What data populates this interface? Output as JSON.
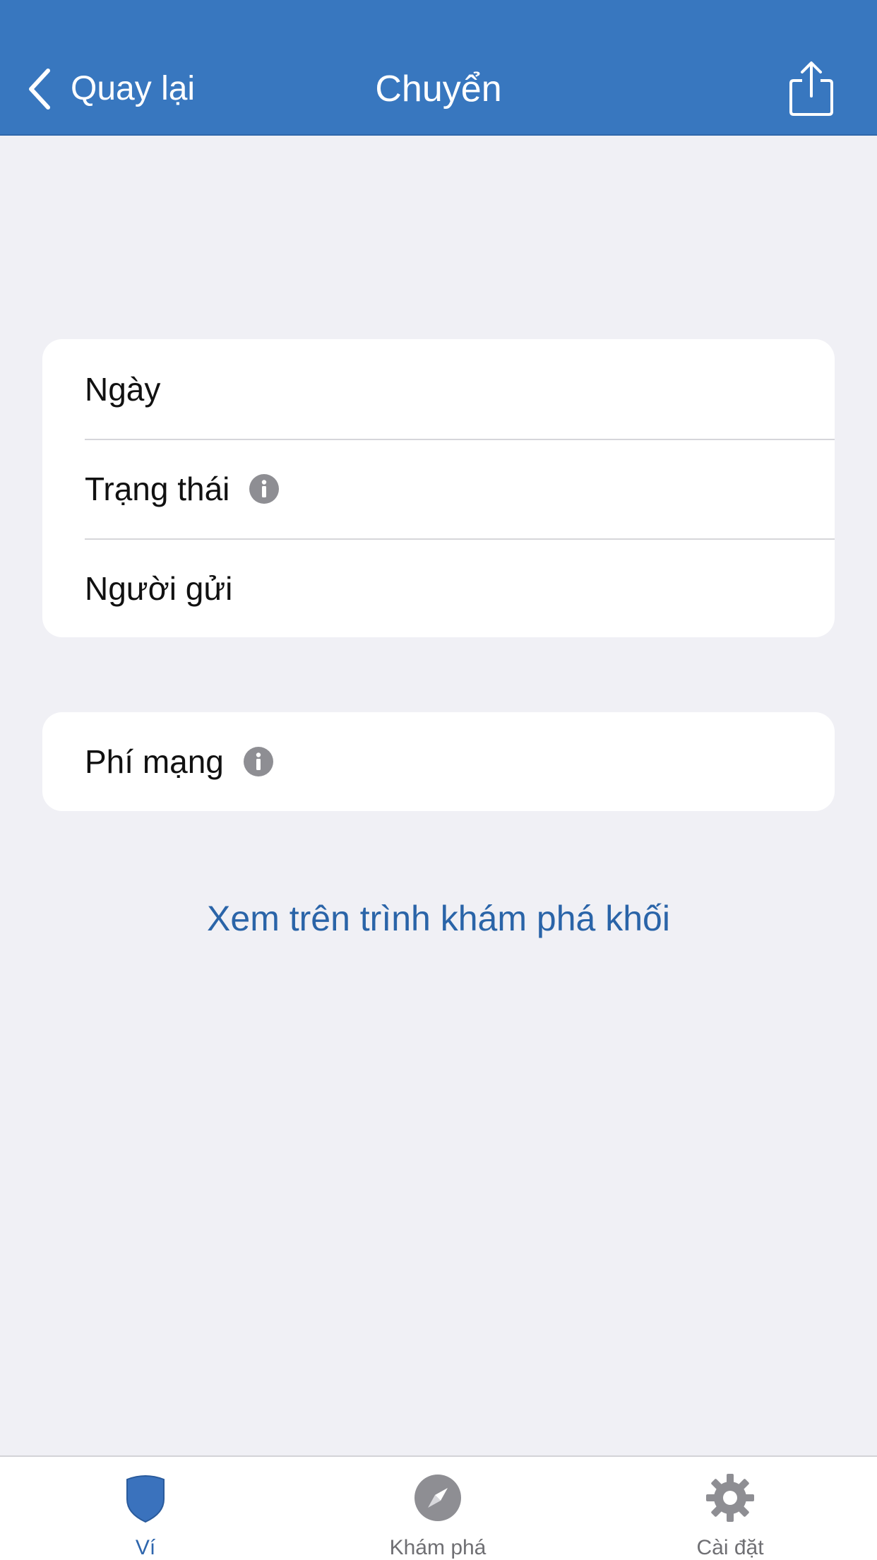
{
  "header": {
    "back_label": "Quay lại",
    "title": "Chuyển",
    "share_icon": "share-icon",
    "color": "#3877bf"
  },
  "details": {
    "rows": [
      {
        "label": "Ngày"
      },
      {
        "label": "Trạng thái",
        "icon": "info-icon"
      },
      {
        "label": "Người gửi"
      }
    ]
  },
  "fee": {
    "label": "Phí mạng",
    "icon": "info-icon"
  },
  "explorer_link": "Xem trên trình khám phá khối",
  "tabbar": {
    "active": "Ví",
    "active_color": "#2e66ad",
    "tabs": [
      {
        "label": "Ví",
        "icon": "shield-icon"
      },
      {
        "label": "Khám phá",
        "icon": "compass-icon"
      },
      {
        "label": "Cài đặt",
        "icon": "gear-icon"
      }
    ]
  }
}
